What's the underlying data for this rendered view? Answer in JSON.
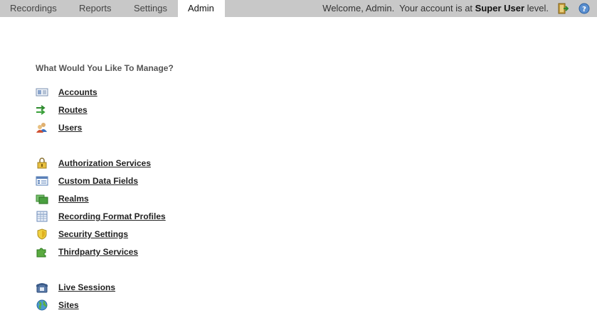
{
  "tabs": [
    {
      "label": "Recordings"
    },
    {
      "label": "Reports"
    },
    {
      "label": "Settings"
    },
    {
      "label": "Admin",
      "active": true
    }
  ],
  "welcome": {
    "prefix": "Welcome, Admin.  Your account is at ",
    "level": "Super User",
    "suffix": " level."
  },
  "toolbar_icons": [
    "logout-icon",
    "help-icon"
  ],
  "main": {
    "heading": "What Would You Like To Manage?",
    "groups": [
      [
        {
          "label": "Accounts",
          "icon": "accounts-card-icon"
        },
        {
          "label": "Routes",
          "icon": "routes-arrows-icon"
        },
        {
          "label": "Users",
          "icon": "users-icon"
        }
      ],
      [
        {
          "label": "Authorization Services",
          "icon": "lock-icon"
        },
        {
          "label": "Custom Data Fields",
          "icon": "form-fields-icon"
        },
        {
          "label": "Realms",
          "icon": "realms-icon"
        },
        {
          "label": "Recording Format Profiles",
          "icon": "grid-table-icon"
        },
        {
          "label": "Security Settings",
          "icon": "shield-icon"
        },
        {
          "label": "Thirdparty Services",
          "icon": "puzzle-icon"
        }
      ],
      [
        {
          "label": "Live Sessions",
          "icon": "phone-icon"
        },
        {
          "label": "Sites",
          "icon": "globe-icon"
        }
      ]
    ]
  }
}
